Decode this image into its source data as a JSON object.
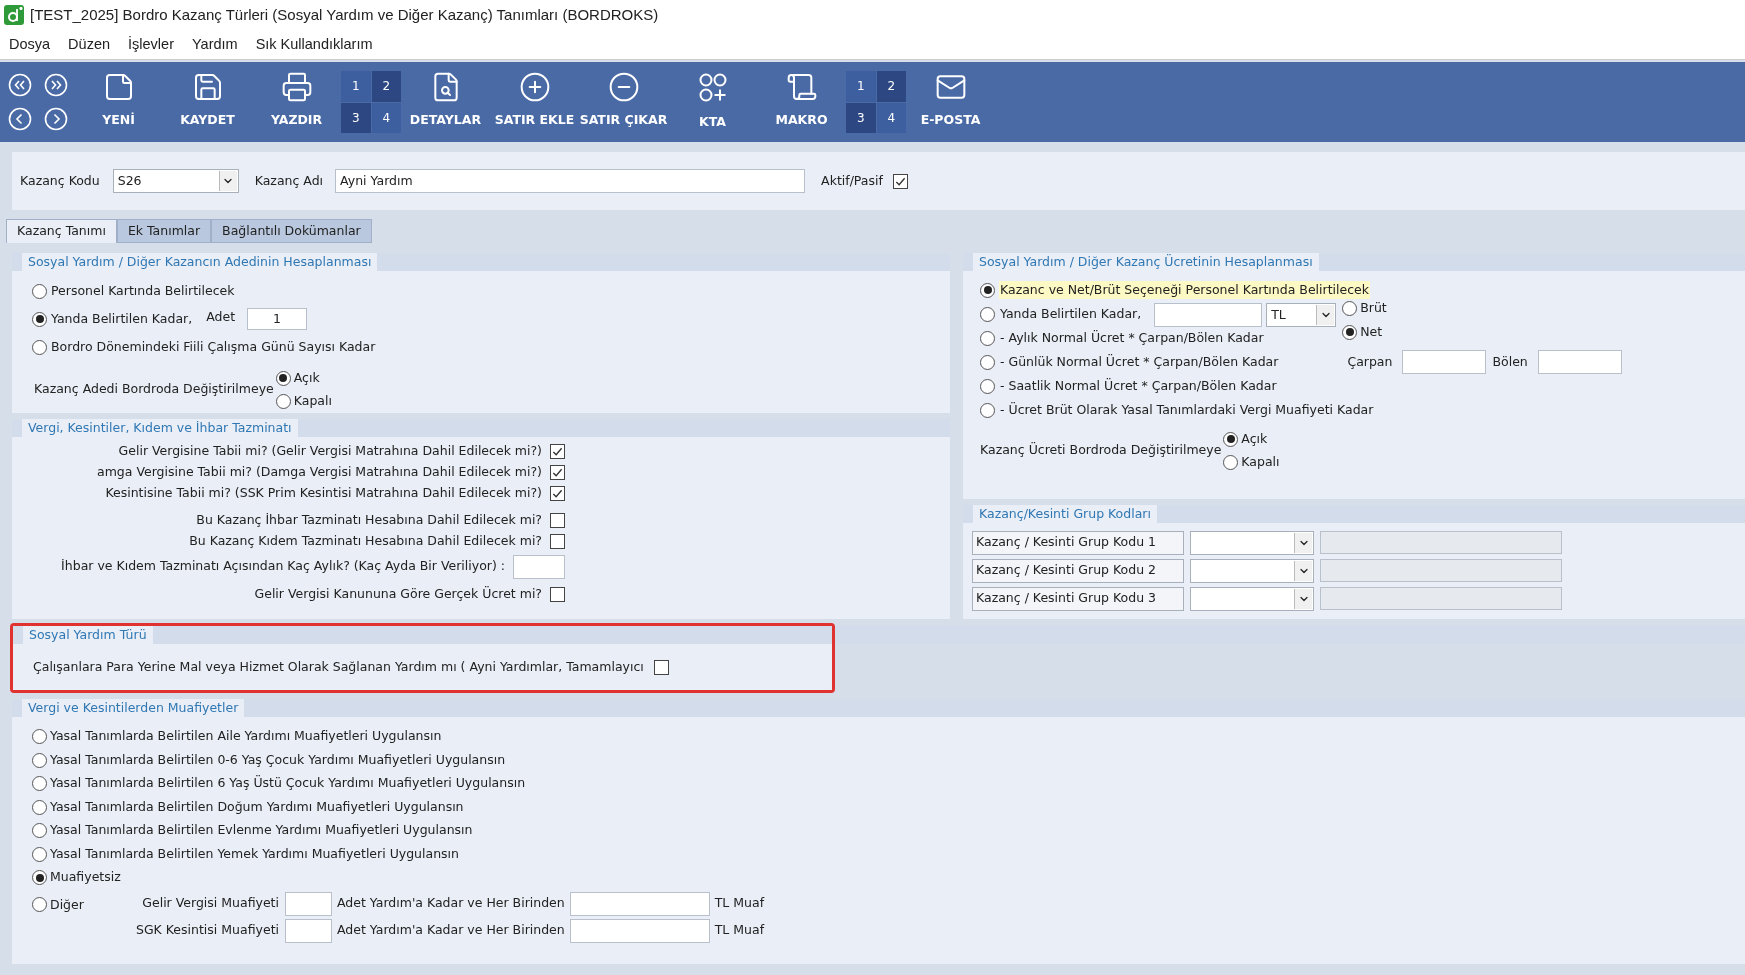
{
  "window": {
    "title": "[TEST_2025] Bordro Kazanç Türleri (Sosyal Yardım ve Diğer Kazanç) Tanımları (BORDROKS)"
  },
  "menu": [
    "Dosya",
    "Düzen",
    "İşlevler",
    "Yardım",
    "Sık Kullandıklarım"
  ],
  "toolbar": [
    {
      "kind": "nav"
    },
    {
      "kind": "button",
      "label": "YENİ"
    },
    {
      "kind": "button",
      "label": "KAYDET"
    },
    {
      "kind": "button",
      "label": "YAZDIR"
    },
    {
      "kind": "pages",
      "pages": [
        "1",
        "2",
        "3",
        "4"
      ]
    },
    {
      "kind": "button",
      "label": "DETAYLAR"
    },
    {
      "kind": "button",
      "label": "SATIR EKLE"
    },
    {
      "kind": "button",
      "label": "SATIR ÇIKAR"
    },
    {
      "kind": "button",
      "label": "KTA"
    },
    {
      "kind": "button",
      "label": "MAKRO"
    },
    {
      "kind": "pages",
      "pages": [
        "1",
        "2",
        "3",
        "4"
      ]
    },
    {
      "kind": "button",
      "label": "E-POSTA"
    }
  ],
  "header": {
    "code": {
      "label": "Kazanç Kodu",
      "value": "S26"
    },
    "name": {
      "label": "Kazanç Adı",
      "value": "Ayni Yardım"
    },
    "active": {
      "label": "Aktif/Pasif",
      "checked": true
    }
  },
  "tabs": [
    {
      "label": "Kazanç Tanımı",
      "selected": true
    },
    {
      "label": "Ek Tanımlar",
      "selected": false
    },
    {
      "label": "Bağlantılı Dokümanlar",
      "selected": false
    }
  ],
  "count_section": {
    "title": "Sosyal Yardım / Diğer Kazancın Adedinin Hesaplanması",
    "options": [
      {
        "label": "Personel Kartında Belirtilecek",
        "selected": false
      },
      {
        "label": "Yanda Belirtilen Kadar,",
        "selected": true
      },
      {
        "label": "Bordro Dönemindeki Fiili Çalışma Günü Sayısı Kadar",
        "selected": false
      }
    ],
    "count_field": {
      "label": "Adet",
      "value": "1"
    },
    "lock": {
      "label": "Kazanç Adedi Bordroda Değiştirilmeye",
      "options": [
        {
          "label": "Açık",
          "selected": true
        },
        {
          "label": "Kapalı",
          "selected": false
        }
      ]
    }
  },
  "tax_section": {
    "title": "Vergi, Kesintiler, Kıdem ve İhbar Tazminatı",
    "items": [
      {
        "kind": "check",
        "label": "Gelir Vergisine Tabii mi? (Gelir Vergisi Matrahına Dahil Edilecek mi?)",
        "checked": true
      },
      {
        "kind": "check",
        "label": "amga Vergisine Tabii mi? (Damga Vergisi Matrahına Dahil Edilecek mi?)",
        "checked": true
      },
      {
        "kind": "check",
        "label": "Kesintisine Tabii mi? (SSK Prim Kesintisi Matrahına Dahil Edilecek mi?)",
        "checked": true
      },
      {
        "kind": "check",
        "label": "Bu Kazanç İhbar Tazminatı Hesabına Dahil Edilecek mi?",
        "checked": false
      },
      {
        "kind": "check",
        "label": "Bu Kazanç Kıdem Tazminatı Hesabına Dahil Edilecek mi?",
        "checked": false
      },
      {
        "kind": "field",
        "label": "İhbar ve Kıdem Tazminatı Açısından Kaç Aylık? (Kaç Ayda Bir Veriliyor) :"
      },
      {
        "kind": "check",
        "label": "Gelir Vergisi Kanununa Göre Gerçek Ücret mi?",
        "checked": false
      }
    ]
  },
  "wage_section": {
    "title": "Sosyal Yardım / Diğer Kazanç Ücretinin Hesaplanması",
    "options": [
      {
        "label": "Kazanc ve Net/Brüt Seçeneği Personel Kartında Belirtilecek",
        "selected": true
      },
      {
        "label": "Yanda Belirtilen Kadar,",
        "selected": false
      },
      {
        "label": "- Aylık Normal Ücret * Çarpan/Bölen Kadar",
        "selected": false
      },
      {
        "label": "- Günlük Normal Ücret * Çarpan/Bölen Kadar",
        "selected": false
      },
      {
        "label": "- Saatlik Normal Ücret * Çarpan/Bölen Kadar",
        "selected": false
      },
      {
        "label": "- Ücret Brüt Olarak Yasal Tanımlardaki Vergi Muafiyeti Kadar",
        "selected": false
      }
    ],
    "currency": {
      "value": "TL"
    },
    "gross_net": [
      {
        "label": "Brüt",
        "selected": false
      },
      {
        "label": "Net",
        "selected": true
      }
    ],
    "multiplier": {
      "label": "Çarpan"
    },
    "divisor": {
      "label": "Bölen"
    },
    "lock": {
      "label": "Kazanç Ücreti Bordroda Değiştirilmeye",
      "options": [
        {
          "label": "Açık",
          "selected": true
        },
        {
          "label": "Kapalı",
          "selected": false
        }
      ]
    }
  },
  "group_section": {
    "title": "Kazanç/Kesinti Grup Kodları",
    "rows": [
      {
        "label": "Kazanç / Kesinti Grup Kodu 1"
      },
      {
        "label": "Kazanç / Kesinti Grup Kodu 2"
      },
      {
        "label": "Kazanç / Kesinti Grup Kodu 3"
      }
    ]
  },
  "aid_type_section": {
    "title": "Sosyal Yardım Türü",
    "check": {
      "label": "Çalışanlara Para Yerine Mal veya Hizmet Olarak Sağlanan Yardım mı ( Ayni Yardımlar, Tamamlayıcı",
      "checked": false
    }
  },
  "exemption_section": {
    "title": "Vergi ve Kesintilerden Muafiyetler",
    "options": [
      {
        "label": "Yasal Tanımlarda Belirtilen Aile Yardımı Muafiyetleri Uygulansın",
        "selected": false
      },
      {
        "label": "Yasal Tanımlarda Belirtilen 0-6 Yaş Çocuk Yardımı Muafiyetleri Uygulansın",
        "selected": false
      },
      {
        "label": "Yasal Tanımlarda Belirtilen 6 Yaş Üstü Çocuk Yardımı Muafiyetleri Uygulansın",
        "selected": false
      },
      {
        "label": "Yasal Tanımlarda Belirtilen Doğum Yardımı Muafiyetleri Uygulansın",
        "selected": false
      },
      {
        "label": "Yasal Tanımlarda Belirtilen Evlenme Yardımı Muafiyetleri Uygulansın",
        "selected": false
      },
      {
        "label": "Yasal Tanımlarda Belirtilen Yemek Yardımı Muafiyetleri Uygulansın",
        "selected": false
      },
      {
        "label": "Muafiyetsiz",
        "selected": true
      },
      {
        "label": "Diğer",
        "selected": false
      }
    ],
    "other_rows": [
      {
        "label": "Gelir Vergisi Muafiyeti",
        "middle": "Adet Yardım'a Kadar ve Her Birinden",
        "suffix": "TL Muaf"
      },
      {
        "label": "SGK Kesintisi Muafiyeti",
        "middle": "Adet Yardım'a Kadar ve Her Birinden",
        "suffix": "TL Muaf"
      }
    ]
  }
}
